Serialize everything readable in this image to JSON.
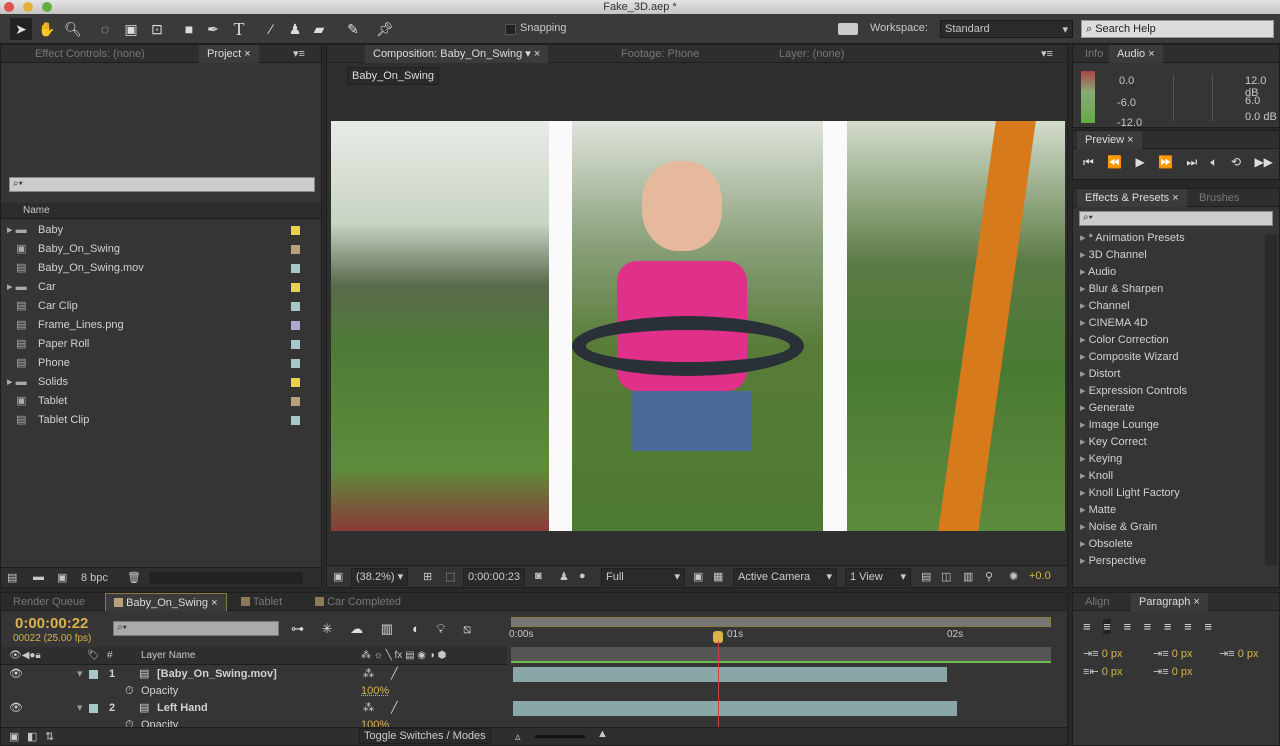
{
  "window": {
    "title": "Fake_3D.aep *"
  },
  "toolbar": {
    "snapping_label": "Snapping",
    "workspace_label": "Workspace:",
    "workspace_value": "Standard",
    "search_placeholder": "Search Help",
    "tools": [
      "selection-tool",
      "hand-tool",
      "zoom-tool",
      "rotate-tool",
      "camera-tool",
      "pan-behind-tool",
      "rectangle-tool",
      "pen-tool",
      "type-tool",
      "brush-tool",
      "clone-stamp-tool",
      "eraser-tool",
      "roto-brush-tool",
      "puppet-pin-tool"
    ]
  },
  "left_panel": {
    "tabs": [
      "Effect Controls: (none)",
      "Project"
    ],
    "column_name": "Name",
    "items": [
      {
        "name": "Baby",
        "type": "folder",
        "color": "#e8d44a"
      },
      {
        "name": "Baby_On_Swing",
        "type": "comp",
        "color": "#b8a07a"
      },
      {
        "name": "Baby_On_Swing.mov",
        "type": "footage",
        "color": "#a8c8c8"
      },
      {
        "name": "Car",
        "type": "folder",
        "color": "#e8d44a"
      },
      {
        "name": "Car Clip",
        "type": "footage",
        "color": "#a8c8c8"
      },
      {
        "name": "Frame_Lines.png",
        "type": "footage",
        "color": "#b0a8d0"
      },
      {
        "name": "Paper Roll",
        "type": "footage",
        "color": "#a8c8c8"
      },
      {
        "name": "Phone",
        "type": "footage",
        "color": "#a8c8c8"
      },
      {
        "name": "Solids",
        "type": "folder",
        "color": "#e8d44a"
      },
      {
        "name": "Tablet",
        "type": "comp",
        "color": "#b8a07a"
      },
      {
        "name": "Tablet Clip",
        "type": "footage",
        "color": "#a8c8c8"
      }
    ],
    "bpc": "8 bpc"
  },
  "viewer": {
    "tabs": [
      "Composition: Baby_On_Swing",
      "Footage: Phone",
      "Layer: (none)"
    ],
    "breadcrumb": "Baby_On_Swing",
    "zoom": "(38.2%)",
    "timecode": "0:00:00:23",
    "resolution": "Full",
    "camera": "Active Camera",
    "views": "1 View",
    "exposure": "+0.0"
  },
  "audio": {
    "tabs": [
      "Info",
      "Audio"
    ],
    "levels_left": [
      "0.0",
      "-6.0",
      "-12.0"
    ],
    "levels_right": [
      "12.0 dB",
      "6.0",
      "0.0 dB"
    ]
  },
  "preview": {
    "tab": "Preview"
  },
  "effects": {
    "tabs": [
      "Effects & Presets",
      "Brushes"
    ],
    "items": [
      "* Animation Presets",
      "3D Channel",
      "Audio",
      "Blur & Sharpen",
      "Channel",
      "CINEMA 4D",
      "Color Correction",
      "Composite Wizard",
      "Distort",
      "Expression Controls",
      "Generate",
      "Image Lounge",
      "Key Correct",
      "Keying",
      "Knoll",
      "Knoll Light Factory",
      "Matte",
      "Noise & Grain",
      "Obsolete",
      "Perspective"
    ]
  },
  "timeline": {
    "tabs": [
      "Render Queue",
      "Baby_On_Swing",
      "Tablet",
      "Car Completed"
    ],
    "current_time": "0:00:00:22",
    "frame_info": "00022 (25.00 fps)",
    "column_layer_name": "Layer Name",
    "column_num": "#",
    "ruler": [
      "0:00s",
      "01s",
      "02s"
    ],
    "layers": [
      {
        "num": "1",
        "name": "[Baby_On_Swing.mov]",
        "prop": "Opacity",
        "value": "100%"
      },
      {
        "num": "2",
        "name": "Left Hand",
        "prop": "Opacity",
        "value": "100%"
      }
    ],
    "toggle_label": "Toggle Switches / Modes"
  },
  "paragraph": {
    "tabs": [
      "Align",
      "Paragraph"
    ],
    "indents": [
      "0 px",
      "0 px",
      "0 px",
      "0 px",
      "0 px"
    ]
  },
  "colors": {
    "accent": "#d8b24a",
    "panel": "#353535",
    "work_area": "#8aa7a7"
  }
}
